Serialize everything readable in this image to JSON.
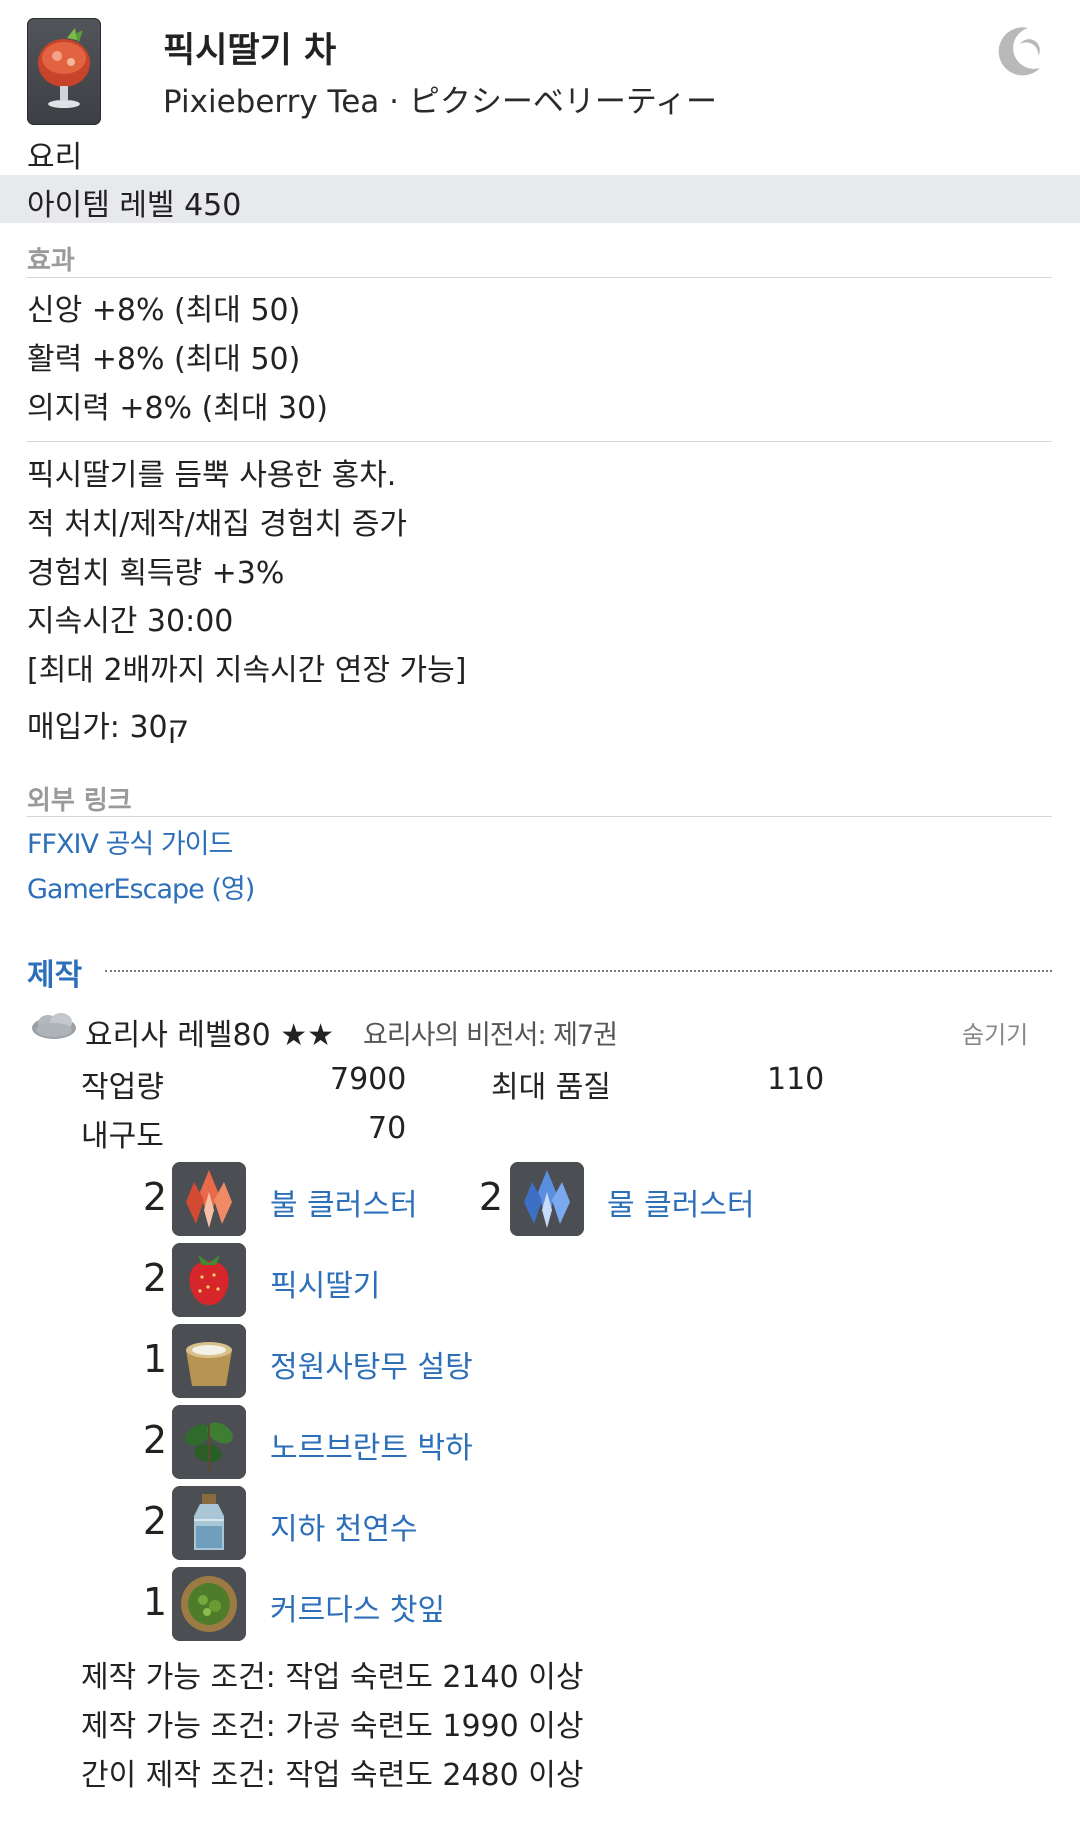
{
  "item": {
    "icon": "pixieberry-tea-icon",
    "name_ko": "픽시딸기 차",
    "name_en_ja": "Pixieberry Tea · ピクシーベリーティー",
    "category": "요리",
    "item_level": "아이템 레벨 450"
  },
  "effects": {
    "label": "효과",
    "lines": [
      "신앙 +8% (최대 50)",
      "활력 +8% (최대 50)",
      "의지력 +8% (최대 30)"
    ]
  },
  "description": {
    "lines": [
      "픽시딸기를 듬뿍 사용한 홍차.",
      "적 처치/제작/채집 경험치 증가",
      "경험치 획득량 +3%",
      "지속시간 30:00",
      "[최대 2배까지 지속시간 연장 가능]"
    ],
    "buy_price": "매입가: 30ק"
  },
  "external_links": {
    "label": "외부 링크",
    "links": [
      "FFXIV 공식 가이드",
      "GamerEscape (영)"
    ]
  },
  "crafting": {
    "heading": "제작",
    "job_line": "요리사 레벨80 ★★",
    "book": "요리사의 비전서: 제7권",
    "hide_label": "숨기기",
    "stats": {
      "workload_label": "작업량",
      "workload_value": "7900",
      "max_quality_label": "최대 품질",
      "max_quality_value": "110",
      "durability_label": "내구도",
      "durability_value": "70"
    },
    "materials": [
      {
        "qty": "2",
        "name": "불 클러스터",
        "icon": "fire-cluster-icon"
      },
      {
        "qty": "2",
        "name": "물 클러스터",
        "icon": "water-cluster-icon"
      },
      {
        "qty": "2",
        "name": "픽시딸기",
        "icon": "pixieberry-icon"
      },
      {
        "qty": "1",
        "name": "정원사탕무 설탕",
        "icon": "sugar-icon"
      },
      {
        "qty": "2",
        "name": "노르브란트 박하",
        "icon": "mint-icon"
      },
      {
        "qty": "2",
        "name": "지하 천연수",
        "icon": "water-bottle-icon"
      },
      {
        "qty": "1",
        "name": "커르다스 찻잎",
        "icon": "tea-leaves-icon"
      }
    ],
    "conditions": [
      "제작 가능 조건: 작업 숙련도 2140 이상",
      "제작 가능 조건: 가공 숙련도 1990 이상",
      "간이 제작 조건: 작업 숙련도 2480 이상"
    ]
  },
  "colors": {
    "link": "#2d6fb8",
    "section_label": "#9a9a9a",
    "item_level_bar": "#e8e9ec"
  }
}
